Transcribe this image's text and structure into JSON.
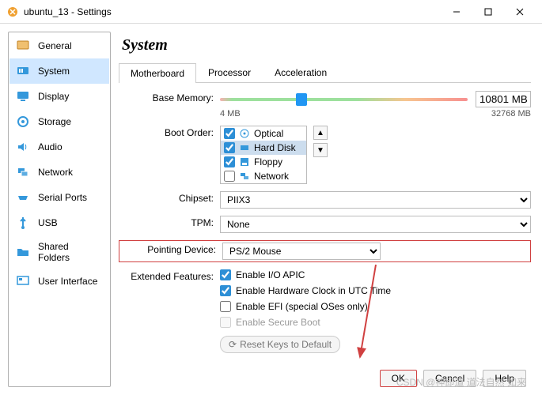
{
  "window": {
    "title": "ubuntu_13 - Settings"
  },
  "sidebar": {
    "items": [
      {
        "label": "General"
      },
      {
        "label": "System"
      },
      {
        "label": "Display"
      },
      {
        "label": "Storage"
      },
      {
        "label": "Audio"
      },
      {
        "label": "Network"
      },
      {
        "label": "Serial Ports"
      },
      {
        "label": "USB"
      },
      {
        "label": "Shared Folders"
      },
      {
        "label": "User Interface"
      }
    ]
  },
  "page": {
    "title": "System"
  },
  "tabs": [
    {
      "label": "Motherboard"
    },
    {
      "label": "Processor"
    },
    {
      "label": "Acceleration"
    }
  ],
  "memory": {
    "label": "Base Memory:",
    "value": "10801 MB",
    "min_label": "4 MB",
    "max_label": "32768 MB",
    "thumb_percent": 33
  },
  "boot": {
    "label": "Boot Order:",
    "items": [
      {
        "label": "Optical",
        "checked": true
      },
      {
        "label": "Hard Disk",
        "checked": true,
        "selected": true
      },
      {
        "label": "Floppy",
        "checked": true
      },
      {
        "label": "Network",
        "checked": false
      }
    ]
  },
  "chipset": {
    "label": "Chipset:",
    "value": "PIIX3"
  },
  "tpm": {
    "label": "TPM:",
    "value": "None"
  },
  "pointing": {
    "label": "Pointing Device:",
    "value": "PS/2 Mouse"
  },
  "ext": {
    "label": "Extended Features:",
    "items": [
      {
        "label": "Enable I/O APIC",
        "checked": true
      },
      {
        "label": "Enable Hardware Clock in UTC Time",
        "checked": true
      },
      {
        "label": "Enable EFI (special OSes only)",
        "checked": false
      },
      {
        "label": "Enable Secure Boot",
        "checked": false,
        "disabled": true
      }
    ],
    "reset_label": "Reset Keys to Default"
  },
  "buttons": {
    "ok": "OK",
    "cancel": "Cancel",
    "help": "Help"
  },
  "watermark": "CSDN @神即道 道法自然 如来"
}
